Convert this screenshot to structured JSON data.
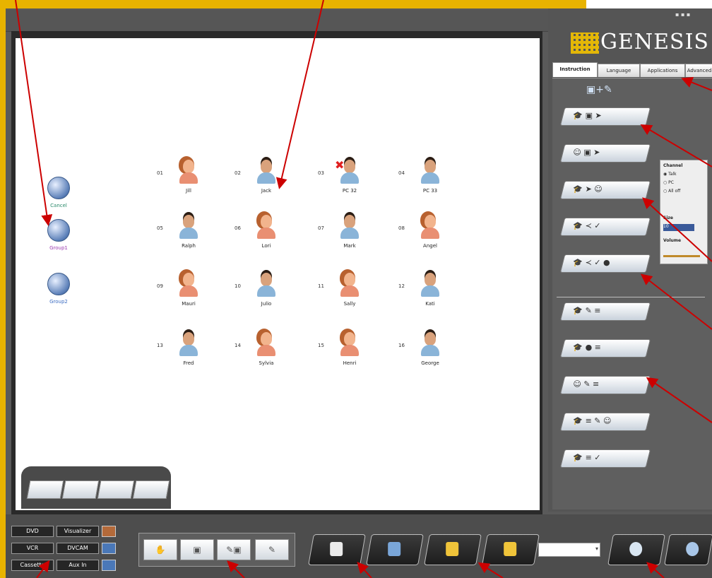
{
  "app": {
    "logo_text": "GENESIS"
  },
  "tabs": [
    {
      "label": "Instruction",
      "active": true
    },
    {
      "label": "Language"
    },
    {
      "label": "Applications"
    },
    {
      "label": "Advanced"
    }
  ],
  "groups": [
    {
      "label": "Cancel",
      "color": "#2a8a6a"
    },
    {
      "label": "Group1",
      "color": "#9b3bb0"
    },
    {
      "label": "Group2",
      "color": "#3a6bc2"
    }
  ],
  "students": [
    {
      "num": "01",
      "name": "Jill",
      "g": "f"
    },
    {
      "num": "02",
      "name": "Jack",
      "g": "m"
    },
    {
      "num": "03",
      "name": "PC 32",
      "g": "m",
      "x": true
    },
    {
      "num": "04",
      "name": "PC 33",
      "g": "m"
    },
    {
      "num": "05",
      "name": "Ralph",
      "g": "m"
    },
    {
      "num": "06",
      "name": "Lori",
      "g": "f"
    },
    {
      "num": "07",
      "name": "Mark",
      "g": "m"
    },
    {
      "num": "08",
      "name": "Angel",
      "g": "f"
    },
    {
      "num": "09",
      "name": "Mauri",
      "g": "f"
    },
    {
      "num": "10",
      "name": "Julio",
      "g": "m"
    },
    {
      "num": "11",
      "name": "Sally",
      "g": "f"
    },
    {
      "num": "12",
      "name": "Kati",
      "g": "m"
    },
    {
      "num": "13",
      "name": "Fred",
      "g": "m"
    },
    {
      "num": "14",
      "name": "Sylvia",
      "g": "f"
    },
    {
      "num": "15",
      "name": "Henri",
      "g": "f"
    },
    {
      "num": "16",
      "name": "George",
      "g": "m"
    }
  ],
  "sidebox": {
    "title": "Channel",
    "options": [
      "Talk",
      "PC",
      "All off"
    ],
    "size_label": "Size",
    "size_value": "10",
    "volume_label": "Volume"
  },
  "sources": [
    {
      "label": "DVD"
    },
    {
      "label": "Visualizer"
    },
    {
      "label": "VCR"
    },
    {
      "label": "DVCAM"
    },
    {
      "label": "Cassette"
    },
    {
      "label": "Aux In"
    }
  ]
}
